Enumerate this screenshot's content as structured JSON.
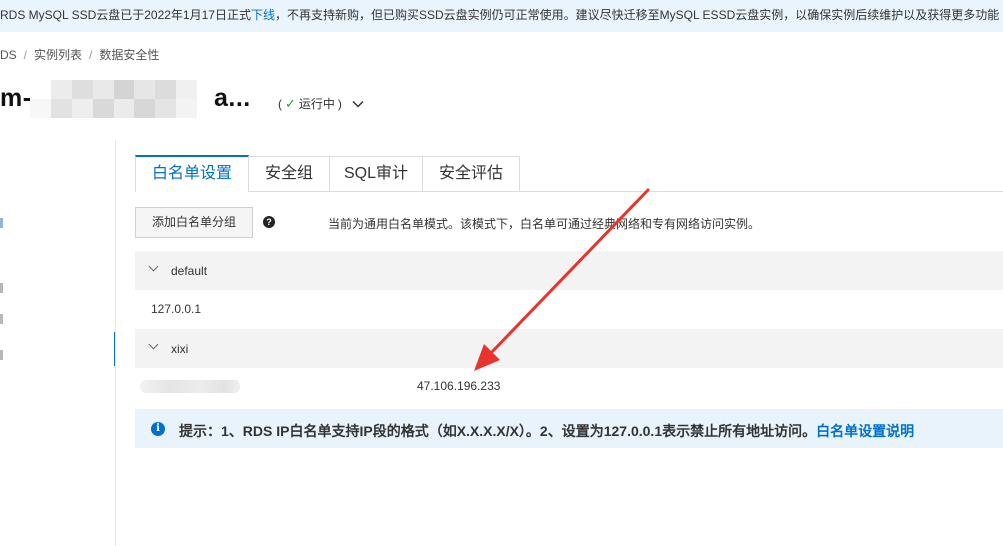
{
  "notice": {
    "text_before": "RDS MySQL SSD云盘已于2022年1月17日正式",
    "link": "下线",
    "text_after": "，不再支持新购，但已购买SSD云盘实例仍可正常使用。建议尽快迁移至MySQL ESSD云盘实例，以确保实例后续维护以及获得更多功能"
  },
  "breadcrumb": {
    "items": [
      "DS",
      "实例列表",
      "数据安全性"
    ],
    "separator": "/"
  },
  "instance": {
    "title_prefix": "m-",
    "title_suffix": "a...",
    "status_open": "(",
    "status_text": "运行中",
    "status_close": ")"
  },
  "tabs": [
    {
      "label": "白名单设置",
      "active": true
    },
    {
      "label": "安全组",
      "active": false
    },
    {
      "label": "SQL审计",
      "active": false
    },
    {
      "label": "安全评估",
      "active": false
    }
  ],
  "toolbar": {
    "add_group_label": "添加白名单分组",
    "help_glyph": "?",
    "mode_hint": "当前为通用白名单模式。该模式下，白名单可通过经典网络和专有网络访问实例。"
  },
  "groups": [
    {
      "name": "default",
      "ips": [
        "127.0.0.1"
      ]
    },
    {
      "name": "xixi",
      "ips": [
        "47.106.196.233"
      ]
    }
  ],
  "tip": {
    "icon_glyph": "i",
    "text": "提示：1、RDS IP白名单支持IP段的格式（如X.X.X.X/X）。2、设置为127.0.0.1表示禁止所有地址访问。",
    "link": "白名单设置说明"
  },
  "colors": {
    "accent": "#0070cc",
    "status_ok": "#1a9e48",
    "annotation_arrow": "#e8342c"
  },
  "icons": {
    "status": "check-icon",
    "status_menu": "chevron-down-icon",
    "group_toggle": "chevron-down-icon",
    "help": "help-icon",
    "tip": "info-icon"
  }
}
